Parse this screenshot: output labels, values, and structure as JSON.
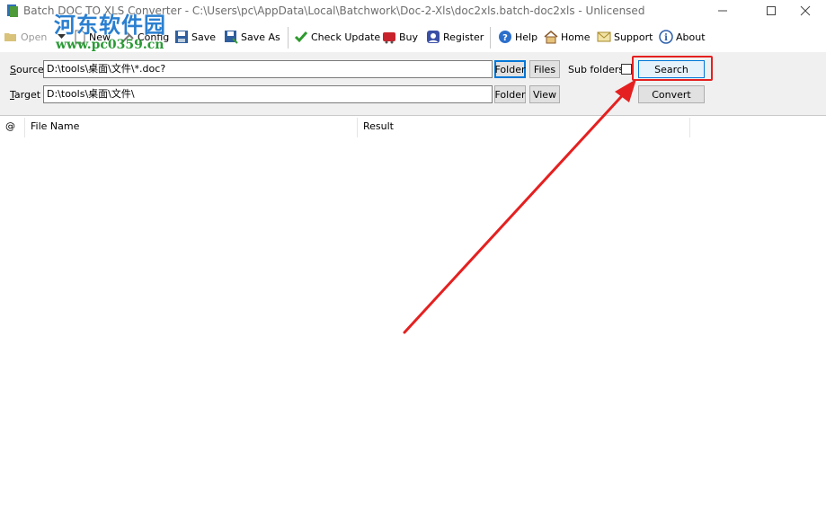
{
  "window": {
    "title": "Batch DOC TO XLS Converter - C:\\Users\\pc\\AppData\\Local\\Batchwork\\Doc-2-Xls\\doc2xls.batch-doc2xls - Unlicensed"
  },
  "watermark": {
    "text": "河东软件园",
    "url": "www.pc0359.cn"
  },
  "toolbar": {
    "open": "Open",
    "new": "New",
    "config": "Config",
    "save": "Save",
    "save_as": "Save As",
    "check_update": "Check Update",
    "buy": "Buy",
    "register": "Register",
    "help": "Help",
    "home": "Home",
    "support": "Support",
    "about": "About"
  },
  "source": {
    "label_accel": "S",
    "label_rest": "ource",
    "value": "D:\\tools\\桌面\\文件\\*.doc?",
    "folder_btn": "Folder",
    "files_btn": "Files"
  },
  "target": {
    "label_accel": "T",
    "label_rest": "arget",
    "value": "D:\\tools\\桌面\\文件\\",
    "folder_btn": "Folder",
    "view_btn": "View"
  },
  "options": {
    "subfolders_label": "Sub folders",
    "subfolders_checked": false,
    "search_btn": "Search",
    "convert_btn": "Convert"
  },
  "table": {
    "columns": [
      "@",
      "File Name",
      "Result"
    ],
    "rows": []
  },
  "colors": {
    "accent": "#0078d7",
    "highlight": "#e52020",
    "panel": "#f0f0f0"
  }
}
